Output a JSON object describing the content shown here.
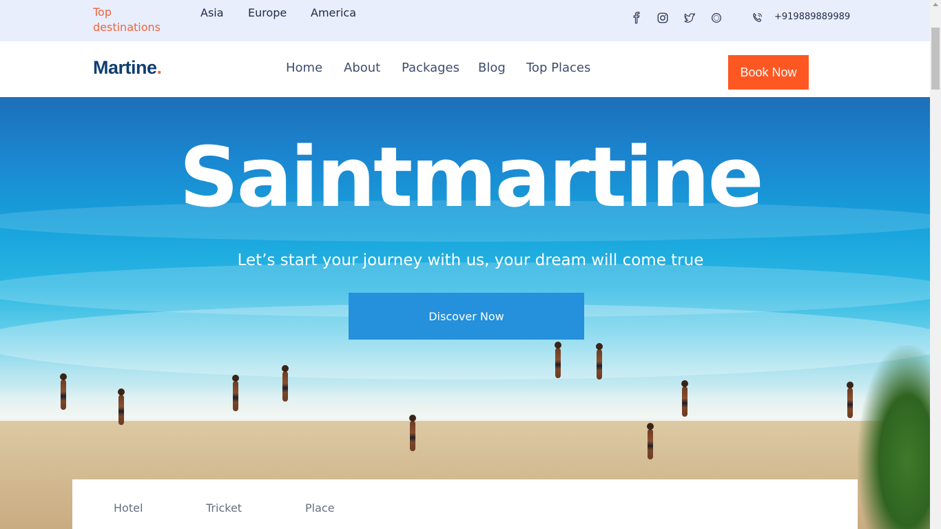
{
  "topbar": {
    "top_destinations": "Top destinations",
    "regions": [
      "Asia",
      "Europe",
      "America"
    ],
    "social": [
      "facebook-icon",
      "instagram-icon",
      "twitter-icon",
      "skype-icon"
    ],
    "phone": "+919889889989"
  },
  "nav": {
    "logo": "Martine",
    "logo_dot": ".",
    "links": [
      "Home",
      "About",
      "Packages",
      "Blog",
      "Top Places"
    ],
    "book_now": "Book Now"
  },
  "hero": {
    "title": "Saintmartine",
    "subtitle": "Let’s start your journey with us, your dream will come true",
    "cta": "Discover Now"
  },
  "search_panel": {
    "tabs": [
      "Hotel",
      "Tricket",
      "Place"
    ]
  },
  "colors": {
    "accent": "#ff5722",
    "primary_blue": "#2590dc",
    "logo_navy": "#0f3e70",
    "topbar_bg": "#e8eefc"
  }
}
